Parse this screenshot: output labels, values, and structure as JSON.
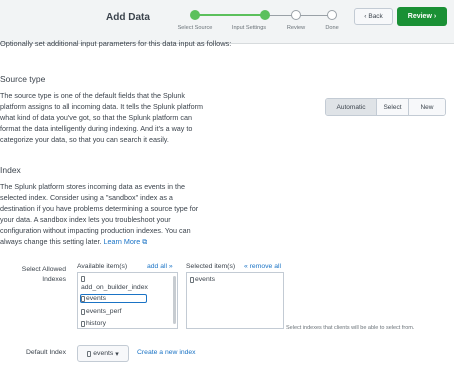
{
  "header": {
    "title": "Add Data",
    "steps": [
      {
        "label": "Select Source",
        "state": "done"
      },
      {
        "label": "Input Settings",
        "state": "done"
      },
      {
        "label": "Review",
        "state": "todo"
      },
      {
        "label": "Done",
        "state": "todo"
      }
    ],
    "back_label": "Back",
    "review_label": "Review",
    "accent_color": "#1a9035",
    "step_done_color": "#5cc05c"
  },
  "intro": "Optionally set additional input parameters for this data input as follows:",
  "source_type": {
    "title": "Source type",
    "lines": [
      "The source type is one of the default fields that the Splunk",
      "platform assigns to all incoming data. It tells the Splunk platform",
      "what kind of data you've got, so that the Splunk platform can",
      "format the data intelligently during indexing. And it's a way to",
      "categorize your data, so that you can search it easily."
    ],
    "options": [
      "Automatic",
      "Select",
      "New"
    ],
    "selected": "Automatic"
  },
  "index": {
    "title": "Index",
    "lines": [
      "The Splunk platform stores incoming data as events in the",
      "selected index. Consider using a \"sandbox\" index as a",
      "destination if you have problems determining a source type for",
      "your data. A sandbox index lets you troubleshoot your",
      "configuration without impacting production indexes. You can",
      "always change this setting later."
    ],
    "learn_more": "Learn More",
    "allowed_label_1": "Select Allowed",
    "allowed_label_2": "Indexes",
    "available_header": "Available item(s)",
    "add_all": "add all »",
    "available_items": [
      "add_on_builder_index",
      "events",
      "events_perf",
      "history"
    ],
    "selected_header": "Selected item(s)",
    "remove_all": "« remove all",
    "selected_items": [
      "events"
    ],
    "hint": "Select indexes that clients will be able to select from.",
    "default_label": "Default Index",
    "default_value": "events",
    "create_link": "Create a new index"
  }
}
